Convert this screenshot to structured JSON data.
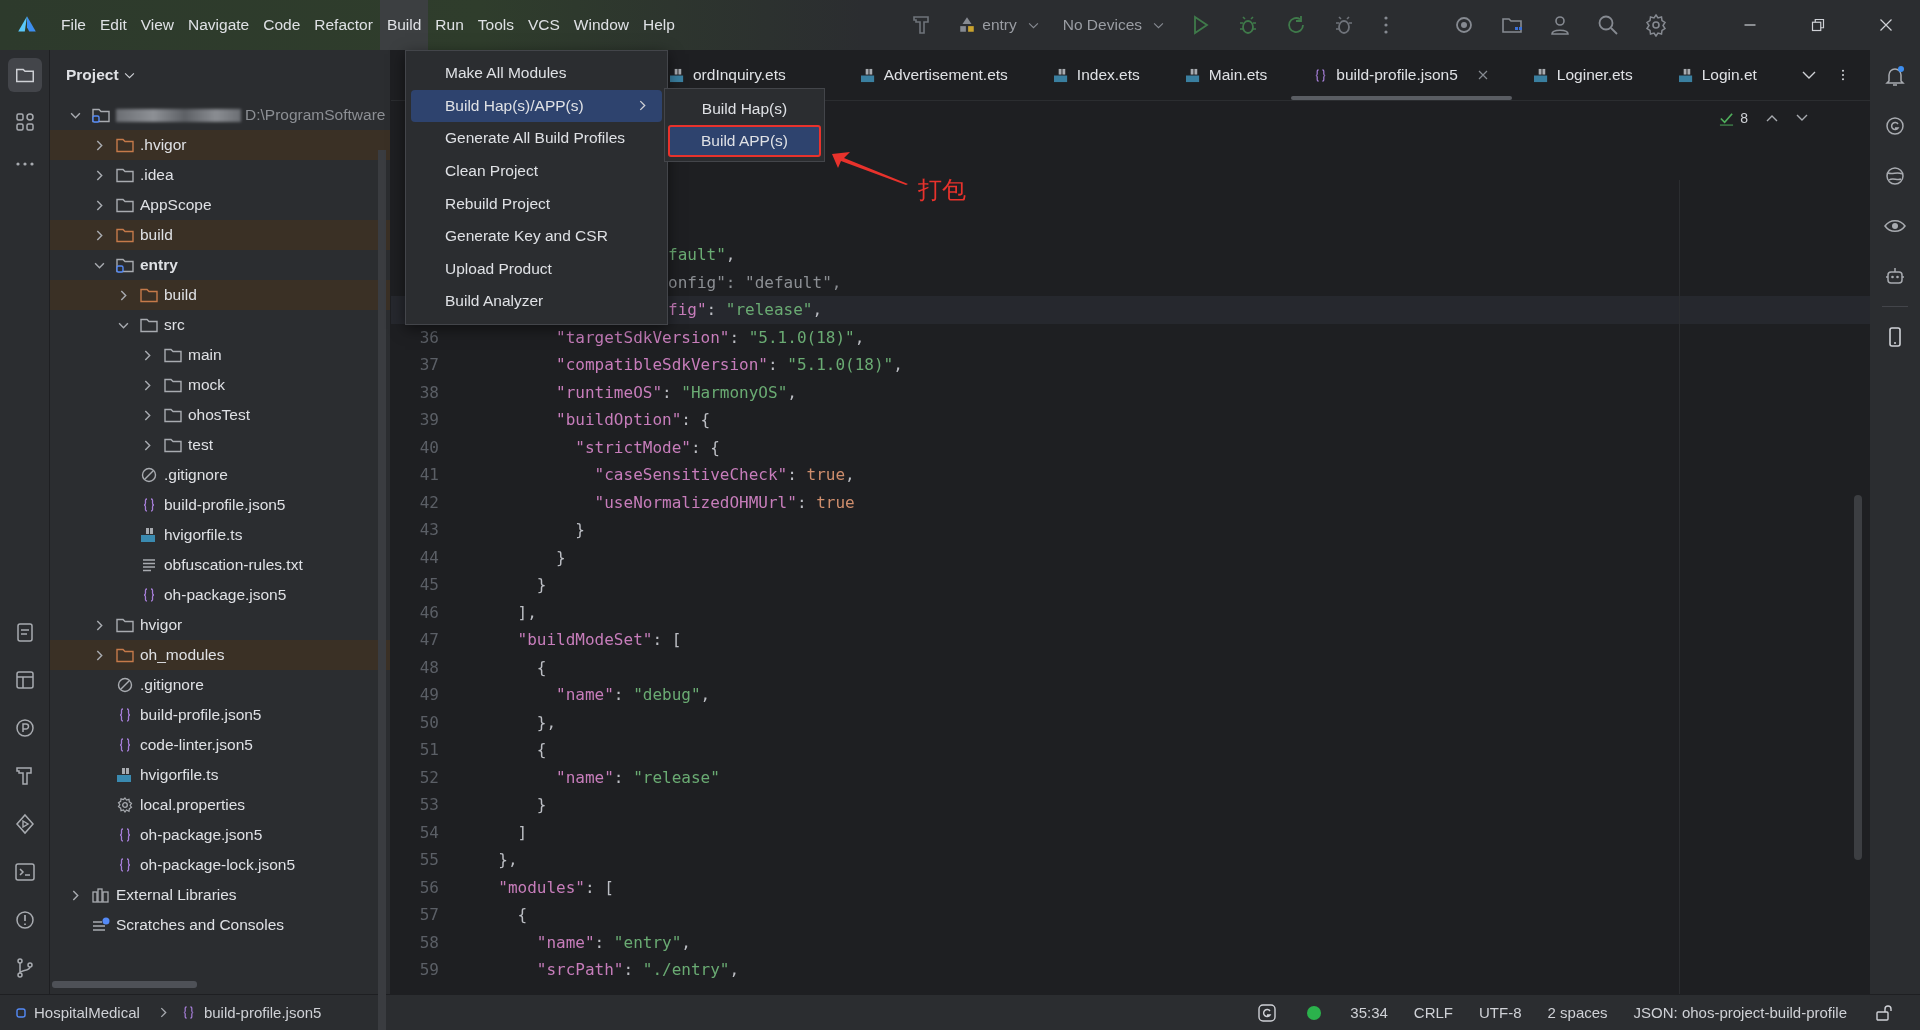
{
  "menu": [
    {
      "label": "File",
      "selected": false
    },
    {
      "label": "Edit",
      "selected": false
    },
    {
      "label": "View",
      "selected": false
    },
    {
      "label": "Navigate",
      "selected": false
    },
    {
      "label": "Code",
      "selected": false
    },
    {
      "label": "Refactor",
      "selected": false
    },
    {
      "label": "Build",
      "selected": true
    },
    {
      "label": "Run",
      "selected": false
    },
    {
      "label": "Tools",
      "selected": false
    },
    {
      "label": "VCS",
      "selected": false
    },
    {
      "label": "Window",
      "selected": false
    },
    {
      "label": "Help",
      "selected": false
    }
  ],
  "toolbar": {
    "run_config": "entry",
    "device": "No Devices"
  },
  "project": {
    "title": "Project",
    "tree": [
      {
        "label": "D:\\ProgramSoftware",
        "kind": "module",
        "redacted": true,
        "expanded": true,
        "children": [
          {
            "label": ".hvigor",
            "kind": "folder",
            "excluded": true,
            "expanded": false
          },
          {
            "label": ".idea",
            "kind": "folder",
            "excluded": false,
            "expanded": false
          },
          {
            "label": "AppScope",
            "kind": "folder",
            "excluded": false,
            "expanded": false
          },
          {
            "label": "build",
            "kind": "folder",
            "excluded": true,
            "expanded": false
          },
          {
            "label": "entry",
            "kind": "module",
            "excluded": false,
            "expanded": true,
            "children": [
              {
                "label": "build",
                "kind": "folder",
                "excluded": true,
                "expanded": false
              },
              {
                "label": "src",
                "kind": "folder",
                "excluded": false,
                "expanded": true,
                "children": [
                  {
                    "label": "main",
                    "kind": "folder",
                    "excluded": false,
                    "expanded": false
                  },
                  {
                    "label": "mock",
                    "kind": "folder",
                    "excluded": false,
                    "expanded": false
                  },
                  {
                    "label": "ohosTest",
                    "kind": "folder",
                    "excluded": false,
                    "expanded": false
                  },
                  {
                    "label": "test",
                    "kind": "folder",
                    "excluded": false,
                    "expanded": false
                  }
                ]
              },
              {
                "label": ".gitignore",
                "kind": "ignore"
              },
              {
                "label": "build-profile.json5",
                "kind": "json"
              },
              {
                "label": "hvigorfile.ts",
                "kind": "ts"
              },
              {
                "label": "obfuscation-rules.txt",
                "kind": "text"
              },
              {
                "label": "oh-package.json5",
                "kind": "json"
              }
            ]
          },
          {
            "label": "hvigor",
            "kind": "folder",
            "excluded": false,
            "expanded": false
          },
          {
            "label": "oh_modules",
            "kind": "folder",
            "excluded": true,
            "expanded": false
          },
          {
            "label": ".gitignore",
            "kind": "ignore"
          },
          {
            "label": "build-profile.json5",
            "kind": "json"
          },
          {
            "label": "code-linter.json5",
            "kind": "json"
          },
          {
            "label": "hvigorfile.ts",
            "kind": "ts"
          },
          {
            "label": "local.properties",
            "kind": "gear"
          },
          {
            "label": "oh-package.json5",
            "kind": "json"
          },
          {
            "label": "oh-package-lock.json5",
            "kind": "json"
          }
        ]
      },
      {
        "label": "External Libraries",
        "kind": "library",
        "expanded": false
      },
      {
        "label": "Scratches and Consoles",
        "kind": "scratch"
      }
    ]
  },
  "tabs": [
    {
      "label": "ordInquiry.ets",
      "kind": "ets",
      "selected": false
    },
    {
      "label": "Advertisement.ets",
      "kind": "ets",
      "selected": false
    },
    {
      "label": "Index.ets",
      "kind": "ets",
      "selected": false
    },
    {
      "label": "Main.ets",
      "kind": "ets",
      "selected": false
    },
    {
      "label": "build-profile.json5",
      "kind": "json",
      "selected": true
    },
    {
      "label": "Loginer.ets",
      "kind": "ets",
      "selected": false
    },
    {
      "label": "Login.et",
      "kind": "ets",
      "selected": false
    }
  ],
  "editor": {
    "problems": "8",
    "lines": [
      {
        "occluded": true,
        "current": false,
        "s": [
          {
            "text": "fault\"",
            "kind": "str"
          },
          {
            "text": ",",
            "kind": "p"
          }
        ]
      },
      {
        "occluded": true,
        "current": false,
        "s": [
          {
            "text": "onfig\": \"default\",",
            "kind": "dim"
          }
        ]
      },
      {
        "occluded": true,
        "current": true,
        "s": [
          {
            "text": "fig\"",
            "kind": "key"
          },
          {
            "text": ": ",
            "kind": "p"
          },
          {
            "text": "\"release\"",
            "kind": "str"
          },
          {
            "text": ",",
            "kind": "p"
          }
        ]
      },
      {
        "n": "36",
        "current": false,
        "s": [
          {
            "text": "        \"targetSdkVersion\"",
            "kind": "key"
          },
          {
            "text": ": ",
            "kind": "p"
          },
          {
            "text": "\"5.1.0(18)\"",
            "kind": "str"
          },
          {
            "text": ",",
            "kind": "p"
          }
        ]
      },
      {
        "n": "37",
        "current": false,
        "s": [
          {
            "text": "        \"compatibleSdkVersion\"",
            "kind": "key"
          },
          {
            "text": ": ",
            "kind": "p"
          },
          {
            "text": "\"5.1.0(18)\"",
            "kind": "str"
          },
          {
            "text": ",",
            "kind": "p"
          }
        ]
      },
      {
        "n": "38",
        "current": false,
        "s": [
          {
            "text": "        \"runtimeOS\"",
            "kind": "key"
          },
          {
            "text": ": ",
            "kind": "p"
          },
          {
            "text": "\"HarmonyOS\"",
            "kind": "str"
          },
          {
            "text": ",",
            "kind": "p"
          }
        ]
      },
      {
        "n": "39",
        "current": false,
        "s": [
          {
            "text": "        \"buildOption\"",
            "kind": "key"
          },
          {
            "text": ": {",
            "kind": "p"
          }
        ]
      },
      {
        "n": "40",
        "current": false,
        "s": [
          {
            "text": "          \"strictMode\"",
            "kind": "key"
          },
          {
            "text": ": {",
            "kind": "p"
          }
        ]
      },
      {
        "n": "41",
        "current": false,
        "s": [
          {
            "text": "            \"caseSensitiveCheck\"",
            "kind": "key"
          },
          {
            "text": ": ",
            "kind": "p"
          },
          {
            "text": "true",
            "kind": "kw"
          },
          {
            "text": ",",
            "kind": "p"
          }
        ]
      },
      {
        "n": "42",
        "current": false,
        "s": [
          {
            "text": "            \"useNormalizedOHMUrl\"",
            "kind": "key"
          },
          {
            "text": ": ",
            "kind": "p"
          },
          {
            "text": "true",
            "kind": "kw"
          }
        ]
      },
      {
        "n": "43",
        "current": false,
        "s": [
          {
            "text": "          }",
            "kind": "p"
          }
        ]
      },
      {
        "n": "44",
        "current": false,
        "s": [
          {
            "text": "        }",
            "kind": "p"
          }
        ]
      },
      {
        "n": "45",
        "current": false,
        "s": [
          {
            "text": "      }",
            "kind": "p"
          }
        ]
      },
      {
        "n": "46",
        "current": false,
        "s": [
          {
            "text": "    ],",
            "kind": "p"
          }
        ]
      },
      {
        "n": "47",
        "current": false,
        "s": [
          {
            "text": "    \"buildModeSet\"",
            "kind": "key"
          },
          {
            "text": ": [",
            "kind": "p"
          }
        ]
      },
      {
        "n": "48",
        "current": false,
        "s": [
          {
            "text": "      {",
            "kind": "p"
          }
        ]
      },
      {
        "n": "49",
        "current": false,
        "s": [
          {
            "text": "        \"name\"",
            "kind": "key"
          },
          {
            "text": ": ",
            "kind": "p"
          },
          {
            "text": "\"debug\"",
            "kind": "str"
          },
          {
            "text": ",",
            "kind": "p"
          }
        ]
      },
      {
        "n": "50",
        "current": false,
        "s": [
          {
            "text": "      },",
            "kind": "p"
          }
        ]
      },
      {
        "n": "51",
        "current": false,
        "s": [
          {
            "text": "      {",
            "kind": "p"
          }
        ]
      },
      {
        "n": "52",
        "current": false,
        "s": [
          {
            "text": "        \"name\"",
            "kind": "key"
          },
          {
            "text": ": ",
            "kind": "p"
          },
          {
            "text": "\"release\"",
            "kind": "str"
          }
        ]
      },
      {
        "n": "53",
        "current": false,
        "s": [
          {
            "text": "      }",
            "kind": "p"
          }
        ]
      },
      {
        "n": "54",
        "current": false,
        "s": [
          {
            "text": "    ]",
            "kind": "p"
          }
        ]
      },
      {
        "n": "55",
        "current": false,
        "s": [
          {
            "text": "  },",
            "kind": "p"
          }
        ]
      },
      {
        "n": "56",
        "current": false,
        "s": [
          {
            "text": "  \"modules\"",
            "kind": "key"
          },
          {
            "text": ": [",
            "kind": "p"
          }
        ]
      },
      {
        "n": "57",
        "current": false,
        "s": [
          {
            "text": "    {",
            "kind": "p"
          }
        ]
      },
      {
        "n": "58",
        "current": false,
        "s": [
          {
            "text": "      \"name\"",
            "kind": "key"
          },
          {
            "text": ": ",
            "kind": "p"
          },
          {
            "text": "\"entry\"",
            "kind": "str"
          },
          {
            "text": ",",
            "kind": "p"
          }
        ]
      },
      {
        "n": "59",
        "current": false,
        "s": [
          {
            "text": "      \"srcPath\"",
            "kind": "key"
          },
          {
            "text": ": ",
            "kind": "p"
          },
          {
            "text": "\"./entry\"",
            "kind": "str"
          },
          {
            "text": ",",
            "kind": "p"
          }
        ]
      }
    ]
  },
  "build_menu": {
    "items": [
      {
        "label": "Make All Modules",
        "selected": false,
        "submenu": false
      },
      {
        "label": "Build Hap(s)/APP(s)",
        "selected": true,
        "submenu": true
      },
      {
        "label": "Generate All Build Profiles",
        "selected": false,
        "submenu": false
      },
      {
        "label": "Clean Project",
        "selected": false,
        "submenu": false
      },
      {
        "label": "Rebuild Project",
        "selected": false,
        "submenu": false
      },
      {
        "label": "Generate Key and CSR",
        "selected": false,
        "submenu": false
      },
      {
        "label": "Upload Product",
        "selected": false,
        "submenu": false
      },
      {
        "label": "Build Analyzer",
        "selected": false,
        "submenu": false
      }
    ],
    "submenu": [
      {
        "label": "Build Hap(s)",
        "selected": false,
        "outlined": false
      },
      {
        "label": "Build APP(s)",
        "selected": true,
        "outlined": true
      }
    ]
  },
  "annotation": {
    "label": "打包"
  },
  "status_bar": {
    "breadcrumbs": [
      "HospitalMedical",
      "build-profile.json5"
    ],
    "position": "35:34",
    "line_ending": "CRLF",
    "encoding": "UTF-8",
    "indent": "2 spaces",
    "schema": "JSON: ohos-project-build-profile"
  }
}
